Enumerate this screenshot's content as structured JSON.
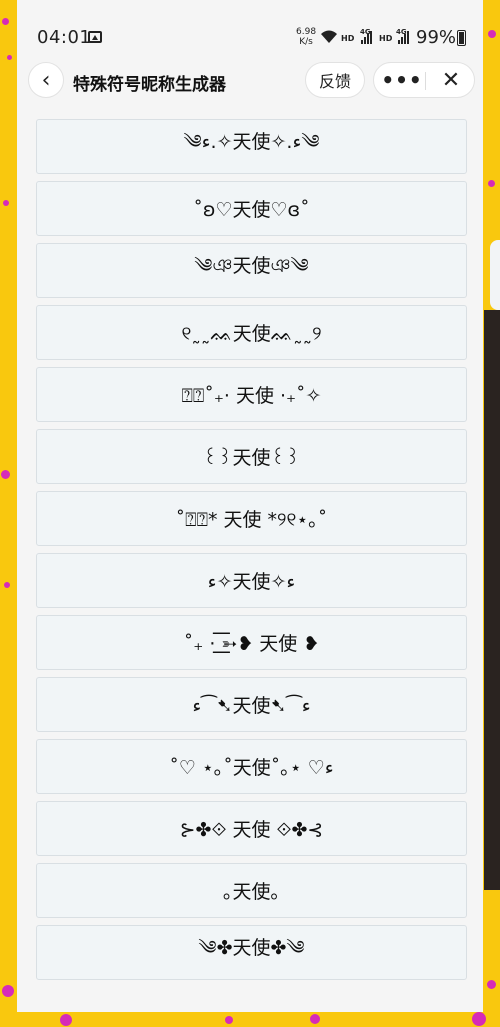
{
  "status_bar": {
    "time": "04:01",
    "net_speed_value": "6.98",
    "net_speed_unit": "K/s",
    "hd_label_1": "HD",
    "hd_label_2": "HD",
    "net_label_1": "4G",
    "net_label_2": "4G",
    "battery": "99%"
  },
  "nav": {
    "back_icon": "‹",
    "title": "特殊符号昵称生成器",
    "feedback_label": "反馈",
    "more_icon": "•••",
    "close_icon": "✕"
  },
  "nicknames": [
    "༄ء.✧天使✧.ء༄",
    "˚ʚ♡天使♡ɞ˚",
    "༄ঞ天使ঞ༄",
    "୧˷˷ᨐ天使ᨐ˷˷୨",
    "⍰⍰˚₊· 天使 ·₊˚✧",
    "꒰꒱天使꒰꒱",
    "˚⍰⍰* 天使 *୨୧⋆｡˚",
    "ء✧天使✧ء",
    "˚₊ · ͟͟͞͞➳❥ 天使 ❥",
    "ء⁀➷天使➷⁀ء",
    "˚♡ ⋆｡˚天使˚｡⋆ ♡ء",
    "⊱✤⟐ 天使 ⟐✤⊰",
    "｡天使｡",
    "༄✤天使✤༄"
  ]
}
